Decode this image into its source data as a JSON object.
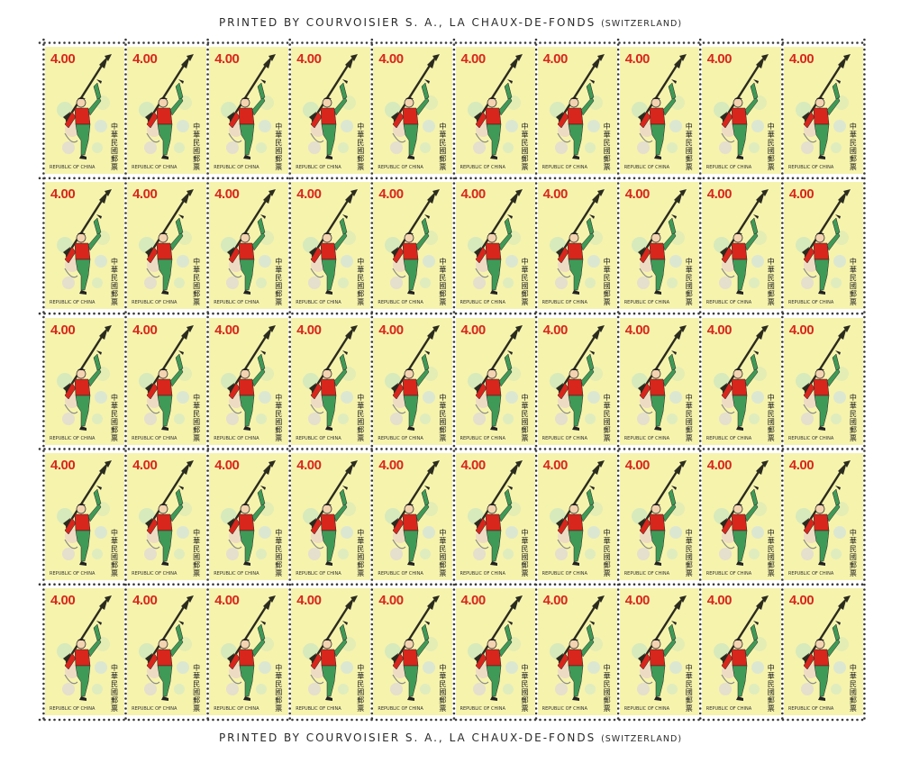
{
  "margin": {
    "top_imprint_main": "PRINTED BY COURVOISIER S. A., LA CHAUX-DE-FONDS",
    "top_imprint_small": "(SWITZERLAND)",
    "bottom_imprint_main": "PRINTED BY COURVOISIER S. A., LA CHAUX-DE-FONDS",
    "bottom_imprint_small": "(SWITZERLAND)"
  },
  "stamp": {
    "denomination": "4.00",
    "country_en": "REPUBLIC OF CHINA",
    "country_zh": "中華民國郵票",
    "rows": 5,
    "cols": 10,
    "colors": {
      "paper": "#f6f3ad",
      "denomination": "#d8261c",
      "jacket": "#d8261c",
      "trousers": "#3f9a57",
      "weapon": "#2b2b1e"
    },
    "subject": "kicking-figure-with-weapon"
  }
}
